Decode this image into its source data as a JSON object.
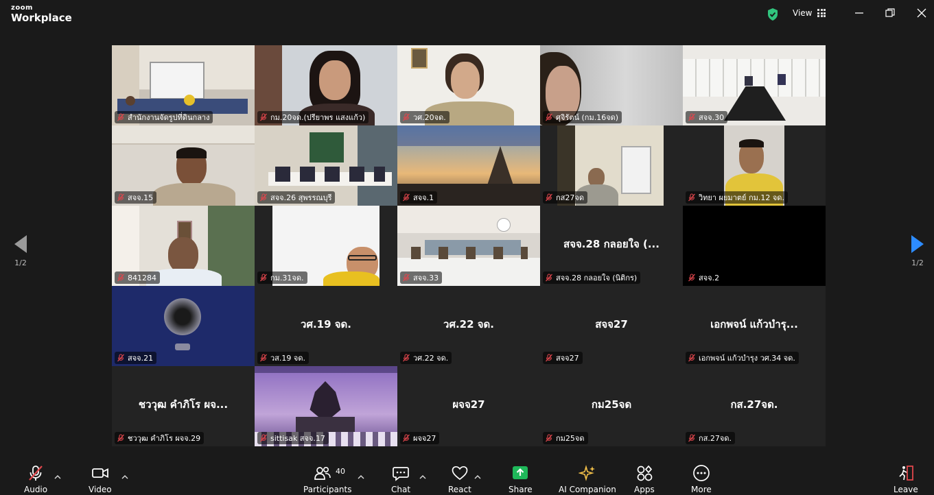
{
  "app": {
    "brand_top": "zoom",
    "brand_bottom": "Workplace",
    "view_label": "View"
  },
  "colors": {
    "active_border": "#31c47e",
    "mic_muted": "#e0464c",
    "share_green": "#1fb85a",
    "pager_active": "#2d8cff"
  },
  "tiles": [
    {
      "name": "สำนักงานจัดรูปที่ดินกลาง",
      "video": true,
      "scene": "room-blue"
    },
    {
      "name": "กม.20จด.(ปรียาพร แสงแก้ว)",
      "video": true,
      "scene": "woman-glasses"
    },
    {
      "name": "วศ.20จด.",
      "video": true,
      "scene": "woman-short"
    },
    {
      "name": "ศุจิรัตน์ (กม.16จด)",
      "video": true,
      "scene": "partial-face"
    },
    {
      "name": "สจจ.30",
      "video": true,
      "scene": "meeting-hall"
    },
    {
      "name": "สจจ.15",
      "video": true,
      "scene": "man-chin"
    },
    {
      "name": "สจจ.26 สุพรรณบุรี",
      "video": true,
      "scene": "office-meeting"
    },
    {
      "name": "สจจ.1",
      "video": true,
      "scene": "landscape-banner"
    },
    {
      "name": "กส27จด",
      "video": true,
      "scene": "office-man"
    },
    {
      "name": "วิทยา ผยมาตย์ กม.12 จด.",
      "video": true,
      "scene": "man-yellow"
    },
    {
      "name": "841284",
      "video": true,
      "scene": "man-green-wall"
    },
    {
      "name": "กม.31จด.",
      "video": true,
      "scene": "man-glasses"
    },
    {
      "name": "สจจ.33",
      "video": true,
      "scene": "conference"
    },
    {
      "name": "สจจ.28 กลอยใจ (นิติกร)",
      "video": false,
      "display": "สจจ.28 กลอยใจ (..."
    },
    {
      "name": "สจจ.2",
      "video": true,
      "scene": "black"
    },
    {
      "name": "สจจ.21",
      "video": true,
      "scene": "blur-logo"
    },
    {
      "name": "วส.19 จด.",
      "video": false,
      "display": "วศ.19 จด."
    },
    {
      "name": "วศ.22 จด.",
      "video": false,
      "display": "วศ.22 จด."
    },
    {
      "name": "สจจ27",
      "video": false,
      "display": "สจจ27"
    },
    {
      "name": "เอกพจน์ แก้วบำรุง วศ.34 จด.",
      "video": false,
      "display": "เอกพจน์ แก้วบำรุ..."
    },
    {
      "name": "ชววุฒ คำภิโร ผจจ.29",
      "video": false,
      "display": "ชววุฒ คำภิโร ผจ..."
    },
    {
      "name": "sittisak สจจ.17",
      "video": true,
      "scene": "elephant-statue"
    },
    {
      "name": "ผจจ27",
      "video": false,
      "display": "ผจจ27"
    },
    {
      "name": "กม25จด",
      "video": false,
      "display": "กม25จด"
    },
    {
      "name": "กส.27จด.",
      "video": false,
      "display": "กส.27จด."
    }
  ],
  "pager": {
    "left": "1/2",
    "right": "1/2"
  },
  "toolbar": {
    "audio": "Audio",
    "video": "Video",
    "participants": "Participants",
    "participants_count": "40",
    "chat": "Chat",
    "react": "React",
    "share": "Share",
    "ai_companion": "AI Companion",
    "apps": "Apps",
    "more": "More",
    "leave": "Leave"
  }
}
